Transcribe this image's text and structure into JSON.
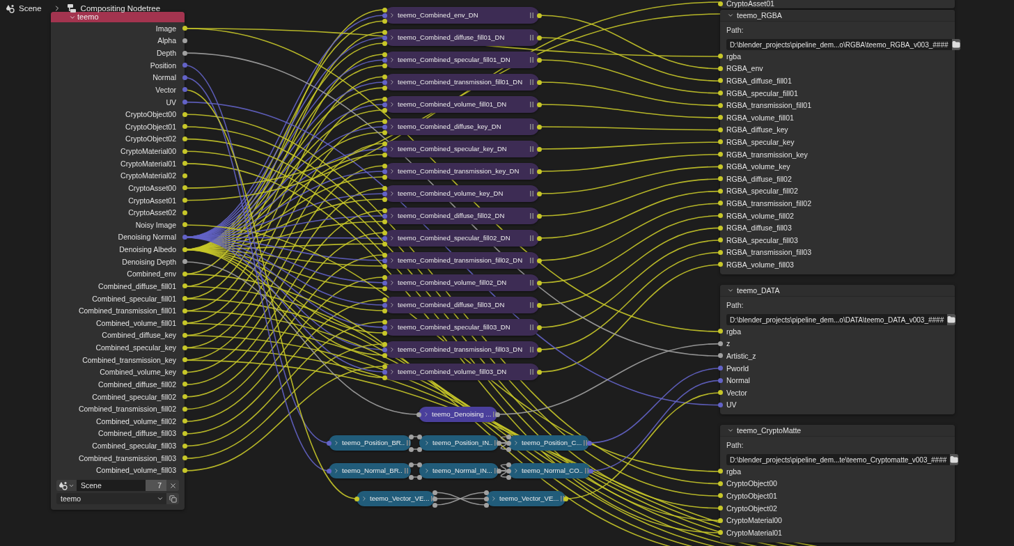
{
  "breadcrumbs": [
    "Scene",
    "Compositing Nodetree"
  ],
  "render_layers_node": {
    "title": "teemo",
    "expanded": true,
    "outputs": [
      {
        "label": "Image",
        "color": "#c7c729"
      },
      {
        "label": "Alpha",
        "color": "#a1a1a1"
      },
      {
        "label": "Depth",
        "color": "#a1a1a1"
      },
      {
        "label": "Position",
        "color": "#6363c7"
      },
      {
        "label": "Normal",
        "color": "#6363c7"
      },
      {
        "label": "Vector",
        "color": "#6363c7"
      },
      {
        "label": "UV",
        "color": "#6363c7"
      },
      {
        "label": "CryptoObject00",
        "color": "#c7c729"
      },
      {
        "label": "CryptoObject01",
        "color": "#c7c729"
      },
      {
        "label": "CryptoObject02",
        "color": "#c7c729"
      },
      {
        "label": "CryptoMaterial00",
        "color": "#c7c729"
      },
      {
        "label": "CryptoMaterial01",
        "color": "#c7c729"
      },
      {
        "label": "CryptoMaterial02",
        "color": "#c7c729"
      },
      {
        "label": "CryptoAsset00",
        "color": "#c7c729"
      },
      {
        "label": "CryptoAsset01",
        "color": "#c7c729"
      },
      {
        "label": "CryptoAsset02",
        "color": "#c7c729"
      },
      {
        "label": "Noisy Image",
        "color": "#c7c729"
      },
      {
        "label": "Denoising Normal",
        "color": "#6363c7"
      },
      {
        "label": "Denoising Albedo",
        "color": "#c7c729"
      },
      {
        "label": "Denoising Depth",
        "color": "#a1a1a1"
      },
      {
        "label": "Combined_env",
        "color": "#c7c729"
      },
      {
        "label": "Combined_diffuse_fill01",
        "color": "#c7c729"
      },
      {
        "label": "Combined_specular_fill01",
        "color": "#c7c729"
      },
      {
        "label": "Combined_transmission_fill01",
        "color": "#c7c729"
      },
      {
        "label": "Combined_volume_fill01",
        "color": "#c7c729"
      },
      {
        "label": "Combined_diffuse_key",
        "color": "#c7c729"
      },
      {
        "label": "Combined_specular_key",
        "color": "#c7c729"
      },
      {
        "label": "Combined_transmission_key",
        "color": "#c7c729"
      },
      {
        "label": "Combined_volume_key",
        "color": "#c7c729"
      },
      {
        "label": "Combined_diffuse_fill02",
        "color": "#c7c729"
      },
      {
        "label": "Combined_specular_fill02",
        "color": "#c7c729"
      },
      {
        "label": "Combined_transmission_fill02",
        "color": "#c7c729"
      },
      {
        "label": "Combined_volume_fill02",
        "color": "#c7c729"
      },
      {
        "label": "Combined_diffuse_fill03",
        "color": "#c7c729"
      },
      {
        "label": "Combined_specular_fill03",
        "color": "#c7c729"
      },
      {
        "label": "Combined_transmission_fill03",
        "color": "#c7c729"
      },
      {
        "label": "Combined_volume_fill03",
        "color": "#c7c729"
      }
    ],
    "scene": "Scene",
    "users": "7",
    "layer": "teemo"
  },
  "group_nodes": [
    {
      "label": "teemo_Combined_env_DN"
    },
    {
      "label": "teemo_Combined_diffuse_fill01_DN"
    },
    {
      "label": "teemo_Combined_specular_fill01_DN"
    },
    {
      "label": "teemo_Combined_transmission_fill01_DN"
    },
    {
      "label": "teemo_Combined_volume_fill01_DN"
    },
    {
      "label": "teemo_Combined_diffuse_key_DN"
    },
    {
      "label": "teemo_Combined_specular_key_DN"
    },
    {
      "label": "teemo_Combined_transmission_key_DN"
    },
    {
      "label": "teemo_Combined_volume_key_DN"
    },
    {
      "label": "teemo_Combined_diffuse_fill02_DN"
    },
    {
      "label": "teemo_Combined_specular_fill02_DN"
    },
    {
      "label": "teemo_Combined_transmission_fill02_DN"
    },
    {
      "label": "teemo_Combined_volume_fill02_DN"
    },
    {
      "label": "teemo_Combined_diffuse_fill03_DN"
    },
    {
      "label": "teemo_Combined_specular_fill03_DN"
    },
    {
      "label": "teemo_Combined_transmission_fill03_DN"
    },
    {
      "label": "teemo_Combined_volume_fill03_DN"
    }
  ],
  "utility_nodes": [
    {
      "label": "teemo_Denoising ...",
      "kind": "denoise",
      "inputs": [
        {
          "color": "#a1a1a1"
        }
      ],
      "outputs": [
        {
          "color": "#a1a1a1"
        }
      ]
    },
    {
      "label": "teemo_Position_BR..",
      "kind": "vector",
      "inputs": [
        {
          "color": "#6363c7"
        }
      ],
      "outputs": [
        {
          "color": "#a1a1a1"
        },
        {
          "color": "#a1a1a1"
        }
      ]
    },
    {
      "label": "teemo_Position_IN..",
      "kind": "vector",
      "inputs": [
        {
          "color": "#a1a1a1"
        },
        {
          "color": "#a1a1a1"
        }
      ],
      "outputs": [
        {
          "color": "#a1a1a1"
        }
      ]
    },
    {
      "label": "teemo_Position_C...",
      "kind": "vector",
      "inputs": [
        {
          "color": "#a1a1a1"
        },
        {
          "color": "#a1a1a1"
        },
        {
          "color": "#a1a1a1"
        }
      ],
      "outputs": [
        {
          "color": "#6363c7"
        }
      ]
    },
    {
      "label": "teemo_Normal_BR..",
      "kind": "vector",
      "inputs": [
        {
          "color": "#6363c7"
        }
      ],
      "outputs": [
        {
          "color": "#a1a1a1"
        },
        {
          "color": "#a1a1a1"
        }
      ]
    },
    {
      "label": "teemo_Normal_IN...",
      "kind": "vector",
      "inputs": [
        {
          "color": "#a1a1a1"
        },
        {
          "color": "#a1a1a1"
        }
      ],
      "outputs": [
        {
          "color": "#a1a1a1"
        }
      ]
    },
    {
      "label": "teemo_Normal_CO..",
      "kind": "vector",
      "inputs": [
        {
          "color": "#a1a1a1"
        },
        {
          "color": "#a1a1a1"
        },
        {
          "color": "#a1a1a1"
        }
      ],
      "outputs": [
        {
          "color": "#6363c7"
        }
      ]
    },
    {
      "label": "teemo_Vector_VE...",
      "kind": "vector",
      "inputs": [
        {
          "color": "#c7c729"
        }
      ],
      "outputs": [
        {
          "color": "#a1a1a1"
        },
        {
          "color": "#a1a1a1"
        },
        {
          "color": "#a1a1a1"
        }
      ]
    },
    {
      "label": "teemo_Vector_VE...",
      "kind": "vector",
      "inputs": [
        {
          "color": "#a1a1a1"
        },
        {
          "color": "#a1a1a1"
        },
        {
          "color": "#a1a1a1"
        }
      ],
      "outputs": [
        {
          "color": "#c7c729"
        }
      ]
    }
  ],
  "partial_node": {
    "inputs": [
      {
        "label": "CryptoAsset01",
        "color": "#c7c729"
      }
    ]
  },
  "output_nodes": [
    {
      "title": "teemo_RGBA",
      "expanded": true,
      "path_label": "Path:",
      "path": "D:\\blender_projects\\pipeline_dem...o\\RGBA\\teemo_RGBA_v003_####",
      "inputs": [
        {
          "label": "rgba",
          "color": "#c7c729"
        },
        {
          "label": "RGBA_env",
          "color": "#c7c729"
        },
        {
          "label": "RGBA_diffuse_fill01",
          "color": "#c7c729"
        },
        {
          "label": "RGBA_specular_fill01",
          "color": "#c7c729"
        },
        {
          "label": "RGBA_transmission_fill01",
          "color": "#c7c729"
        },
        {
          "label": "RGBA_volume_fill01",
          "color": "#c7c729"
        },
        {
          "label": "RGBA_diffuse_key",
          "color": "#c7c729"
        },
        {
          "label": "RGBA_specular_key",
          "color": "#c7c729"
        },
        {
          "label": "RGBA_transmission_key",
          "color": "#c7c729"
        },
        {
          "label": "RGBA_volume_key",
          "color": "#c7c729"
        },
        {
          "label": "RGBA_diffuse_fill02",
          "color": "#c7c729"
        },
        {
          "label": "RGBA_specular_fill02",
          "color": "#c7c729"
        },
        {
          "label": "RGBA_transmission_fill02",
          "color": "#c7c729"
        },
        {
          "label": "RGBA_volume_fill02",
          "color": "#c7c729"
        },
        {
          "label": "RGBA_diffuse_fill03",
          "color": "#c7c729"
        },
        {
          "label": "RGBA_specular_fill03",
          "color": "#c7c729"
        },
        {
          "label": "RGBA_transmission_fill03",
          "color": "#c7c729"
        },
        {
          "label": "RGBA_volume_fill03",
          "color": "#c7c729"
        }
      ]
    },
    {
      "title": "teemo_DATA",
      "expanded": true,
      "path_label": "Path:",
      "path": "D:\\blender_projects\\pipeline_dem...o\\DATA\\teemo_DATA_v003_####",
      "inputs": [
        {
          "label": "rgba",
          "color": "#c7c729"
        },
        {
          "label": "z",
          "color": "#a1a1a1"
        },
        {
          "label": "Artistic_z",
          "color": "#a1a1a1"
        },
        {
          "label": "Pworld",
          "color": "#6363c7"
        },
        {
          "label": "Normal",
          "color": "#6363c7"
        },
        {
          "label": "Vector",
          "color": "#c7c729"
        },
        {
          "label": "UV",
          "color": "#6363c7"
        }
      ]
    },
    {
      "title": "teemo_CryptoMatte",
      "expanded": true,
      "path_label": "Path:",
      "path": "D:\\blender_projects\\pipeline_dem...te\\teemo_Cryptomatte_v003_####",
      "inputs": [
        {
          "label": "rgba",
          "color": "#c7c729"
        },
        {
          "label": "CryptoObject00",
          "color": "#c7c729"
        },
        {
          "label": "CryptoObject01",
          "color": "#c7c729"
        },
        {
          "label": "CryptoObject02",
          "color": "#c7c729"
        },
        {
          "label": "CryptoMaterial00",
          "color": "#c7c729"
        },
        {
          "label": "CryptoMaterial01",
          "color": "#c7c729"
        }
      ]
    }
  ]
}
